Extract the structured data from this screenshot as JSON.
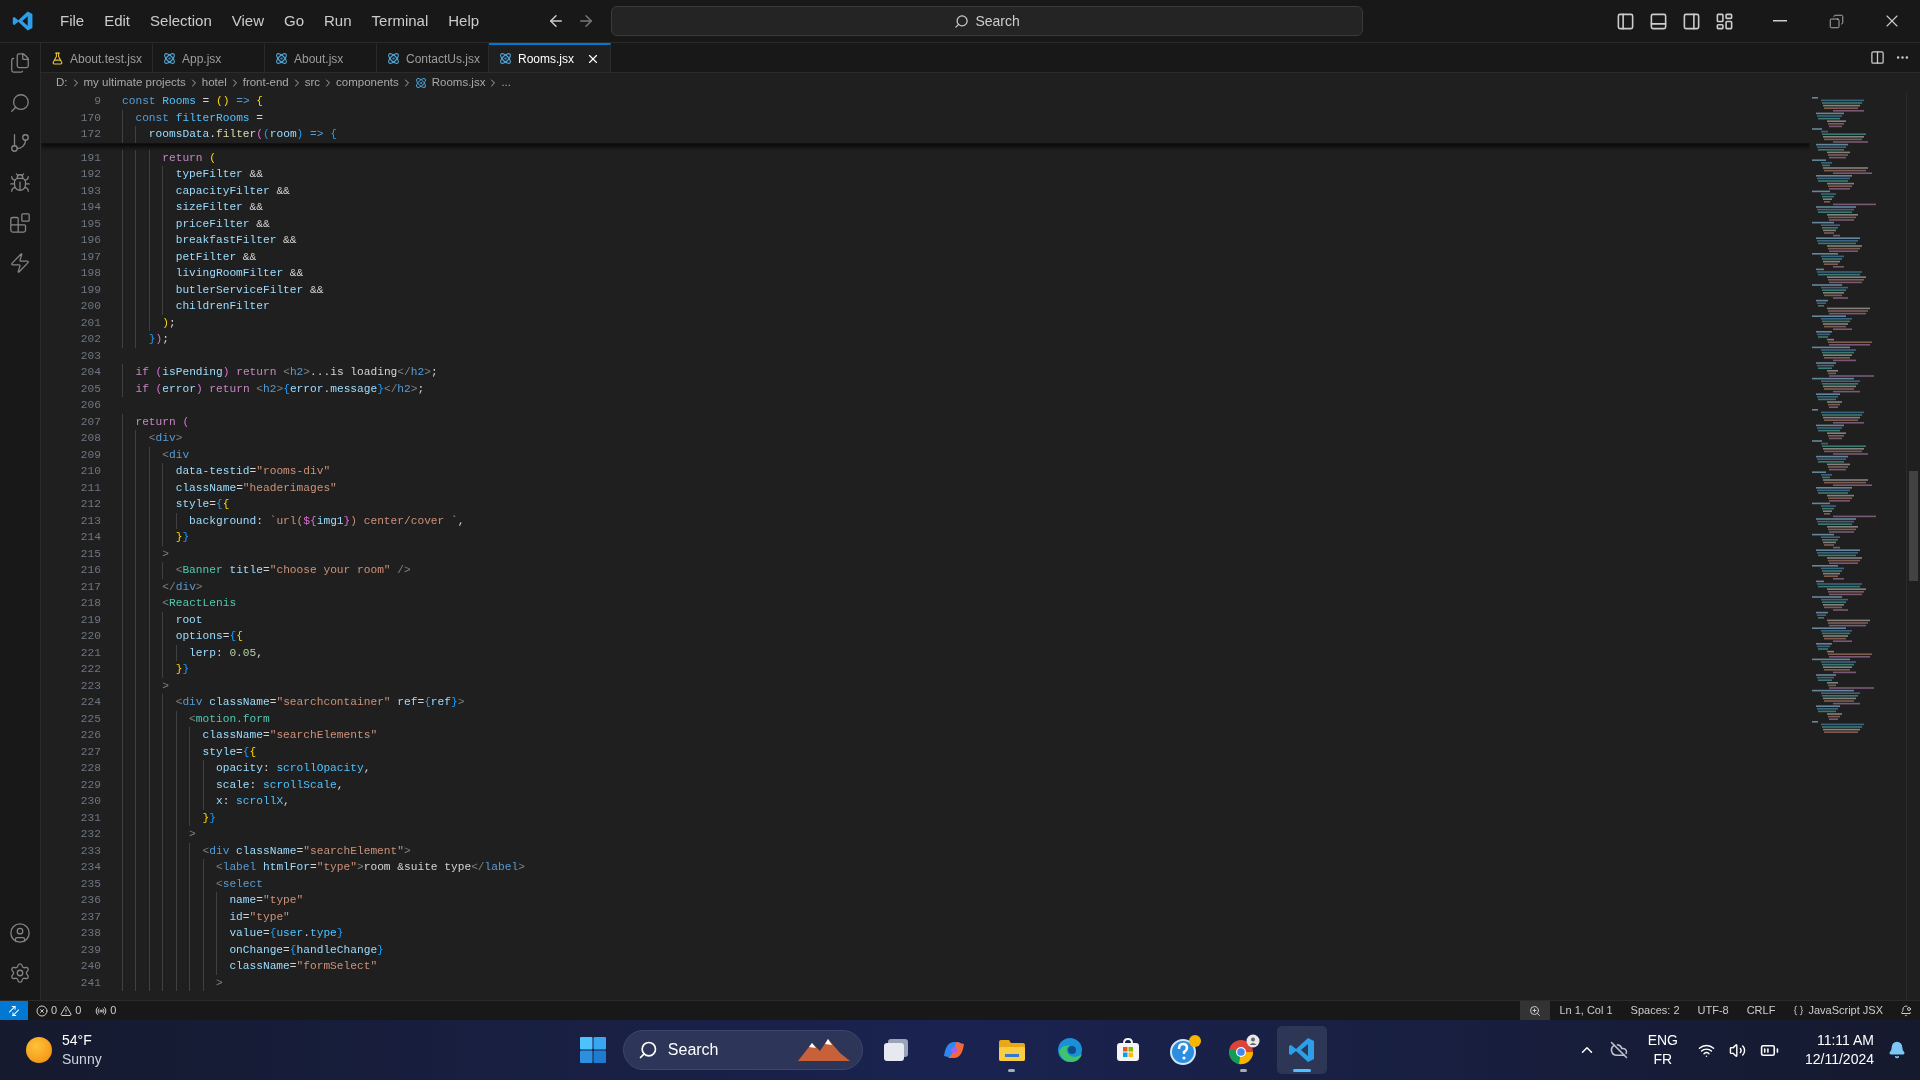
{
  "title_bar": {
    "menu": [
      "File",
      "Edit",
      "Selection",
      "View",
      "Go",
      "Run",
      "Terminal",
      "Help"
    ],
    "command_center": "Search"
  },
  "tabs": [
    {
      "label": "About.test.jsx",
      "kind": "test",
      "selected": false
    },
    {
      "label": "App.jsx",
      "kind": "react",
      "selected": false
    },
    {
      "label": "About.jsx",
      "kind": "react",
      "selected": false
    },
    {
      "label": "ContactUs.jsx",
      "kind": "react",
      "selected": false
    },
    {
      "label": "Rooms.jsx",
      "kind": "react",
      "selected": true
    }
  ],
  "breadcrumb": [
    {
      "label": "D:",
      "kind": "folder"
    },
    {
      "label": "my ultimate projects",
      "kind": "folder"
    },
    {
      "label": "hotel",
      "kind": "folder"
    },
    {
      "label": "front-end",
      "kind": "folder"
    },
    {
      "label": "src",
      "kind": "folder"
    },
    {
      "label": "components",
      "kind": "folder"
    },
    {
      "label": "Rooms.jsx",
      "kind": "file"
    },
    {
      "label": "...",
      "kind": "more"
    }
  ],
  "sticky_lines": [
    {
      "n": "9",
      "tokens": [
        {
          "text": "const ",
          "kind": "storage"
        },
        {
          "text": "Rooms",
          "kind": "constant"
        },
        {
          "text": " = ",
          "kind": "plain"
        },
        {
          "text": "()",
          "kind": "bracket1"
        },
        {
          "text": " => ",
          "kind": "storage"
        },
        {
          "text": "{",
          "kind": "bracket1"
        }
      ]
    },
    {
      "n": "170",
      "tokens": [
        {
          "text": "  const ",
          "kind": "storage"
        },
        {
          "text": "filterRooms",
          "kind": "constant"
        },
        {
          "text": " =",
          "kind": "plain"
        }
      ]
    },
    {
      "n": "172",
      "tokens": [
        {
          "text": "    roomsData",
          "kind": "variable"
        },
        {
          "text": ".",
          "kind": "plain"
        },
        {
          "text": "filter",
          "kind": "function"
        },
        {
          "text": "(",
          "kind": "bracket2"
        },
        {
          "text": "(",
          "kind": "bracket3"
        },
        {
          "text": "room",
          "kind": "variable"
        },
        {
          "text": ")",
          "kind": "bracket3"
        },
        {
          "text": " => ",
          "kind": "storage"
        },
        {
          "text": "{",
          "kind": "bracket3"
        }
      ]
    }
  ],
  "lines": [
    {
      "n": "191",
      "tokens": [
        {
          "text": "      return ",
          "kind": "keyword"
        },
        {
          "text": "(",
          "kind": "bracket1"
        }
      ]
    },
    {
      "n": "192",
      "tokens": [
        {
          "text": "        typeFilter",
          "kind": "variable"
        },
        {
          "text": " &&",
          "kind": "plain"
        }
      ]
    },
    {
      "n": "193",
      "tokens": [
        {
          "text": "        capacityFilter",
          "kind": "variable"
        },
        {
          "text": " &&",
          "kind": "plain"
        }
      ]
    },
    {
      "n": "194",
      "tokens": [
        {
          "text": "        sizeFilter",
          "kind": "variable"
        },
        {
          "text": " &&",
          "kind": "plain"
        }
      ]
    },
    {
      "n": "195",
      "tokens": [
        {
          "text": "        priceFilter",
          "kind": "variable"
        },
        {
          "text": " &&",
          "kind": "plain"
        }
      ]
    },
    {
      "n": "196",
      "tokens": [
        {
          "text": "        breakfastFilter",
          "kind": "variable"
        },
        {
          "text": " &&",
          "kind": "plain"
        }
      ]
    },
    {
      "n": "197",
      "tokens": [
        {
          "text": "        petFilter",
          "kind": "variable"
        },
        {
          "text": " &&",
          "kind": "plain"
        }
      ]
    },
    {
      "n": "198",
      "tokens": [
        {
          "text": "        livingRoomFilter",
          "kind": "variable"
        },
        {
          "text": " &&",
          "kind": "plain"
        }
      ]
    },
    {
      "n": "199",
      "tokens": [
        {
          "text": "        butlerServiceFilter",
          "kind": "variable"
        },
        {
          "text": " &&",
          "kind": "plain"
        }
      ]
    },
    {
      "n": "200",
      "tokens": [
        {
          "text": "        childrenFilter",
          "kind": "variable"
        }
      ]
    },
    {
      "n": "201",
      "tokens": [
        {
          "text": "      )",
          "kind": "bracket1"
        },
        {
          "text": ";",
          "kind": "plain"
        }
      ]
    },
    {
      "n": "202",
      "tokens": [
        {
          "text": "    }",
          "kind": "bracket3"
        },
        {
          "text": ")",
          "kind": "bracket2"
        },
        {
          "text": ";",
          "kind": "plain"
        }
      ]
    },
    {
      "n": "203"
    },
    {
      "n": "204",
      "tokens": [
        {
          "text": "  if ",
          "kind": "keyword"
        },
        {
          "text": "(",
          "kind": "bracket2"
        },
        {
          "text": "isPending",
          "kind": "variable"
        },
        {
          "text": ")",
          "kind": "bracket2"
        },
        {
          "text": " return ",
          "kind": "keyword"
        },
        {
          "text": "<",
          "kind": "punctuation"
        },
        {
          "text": "h2",
          "kind": "tag"
        },
        {
          "text": ">",
          "kind": "punctuation"
        },
        {
          "text": "...is loading",
          "kind": "plain"
        },
        {
          "text": "</",
          "kind": "punctuation"
        },
        {
          "text": "h2",
          "kind": "tag"
        },
        {
          "text": ">",
          "kind": "punctuation"
        },
        {
          "text": ";",
          "kind": "plain"
        }
      ]
    },
    {
      "n": "205",
      "tokens": [
        {
          "text": "  if ",
          "kind": "keyword"
        },
        {
          "text": "(",
          "kind": "bracket2"
        },
        {
          "text": "error",
          "kind": "variable"
        },
        {
          "text": ")",
          "kind": "bracket2"
        },
        {
          "text": " return ",
          "kind": "keyword"
        },
        {
          "text": "<",
          "kind": "punctuation"
        },
        {
          "text": "h2",
          "kind": "tag"
        },
        {
          "text": ">",
          "kind": "punctuation"
        },
        {
          "text": "{",
          "kind": "bracket3"
        },
        {
          "text": "error",
          "kind": "variable"
        },
        {
          "text": ".",
          "kind": "plain"
        },
        {
          "text": "message",
          "kind": "variable"
        },
        {
          "text": "}",
          "kind": "bracket3"
        },
        {
          "text": "</",
          "kind": "punctuation"
        },
        {
          "text": "h2",
          "kind": "tag"
        },
        {
          "text": ">",
          "kind": "punctuation"
        },
        {
          "text": ";",
          "kind": "plain"
        }
      ]
    },
    {
      "n": "206"
    },
    {
      "n": "207",
      "tokens": [
        {
          "text": "  return ",
          "kind": "keyword"
        },
        {
          "text": "(",
          "kind": "bracket2"
        }
      ]
    },
    {
      "n": "208",
      "tokens": [
        {
          "text": "    <",
          "kind": "punctuation"
        },
        {
          "text": "div",
          "kind": "tag"
        },
        {
          "text": ">",
          "kind": "punctuation"
        }
      ]
    },
    {
      "n": "209",
      "tokens": [
        {
          "text": "      <",
          "kind": "punctuation"
        },
        {
          "text": "div",
          "kind": "tag"
        }
      ]
    },
    {
      "n": "210",
      "tokens": [
        {
          "text": "        data-testid",
          "kind": "variable"
        },
        {
          "text": "=",
          "kind": "plain"
        },
        {
          "text": "\"rooms-div\"",
          "kind": "string"
        }
      ]
    },
    {
      "n": "211",
      "tokens": [
        {
          "text": "        className",
          "kind": "variable"
        },
        {
          "text": "=",
          "kind": "plain"
        },
        {
          "text": "\"headerimages\"",
          "kind": "string"
        }
      ]
    },
    {
      "n": "212",
      "tokens": [
        {
          "text": "        style",
          "kind": "variable"
        },
        {
          "text": "=",
          "kind": "plain"
        },
        {
          "text": "{",
          "kind": "bracket3"
        },
        {
          "text": "{",
          "kind": "bracket1"
        }
      ]
    },
    {
      "n": "213",
      "tokens": [
        {
          "text": "          background",
          "kind": "variable"
        },
        {
          "text": ": ",
          "kind": "plain"
        },
        {
          "text": "`url(",
          "kind": "string"
        },
        {
          "text": "${",
          "kind": "bracket2"
        },
        {
          "text": "img1",
          "kind": "variable"
        },
        {
          "text": "}",
          "kind": "bracket2"
        },
        {
          "text": ") center/cover `",
          "kind": "string"
        },
        {
          "text": ",",
          "kind": "plain"
        }
      ]
    },
    {
      "n": "214",
      "tokens": [
        {
          "text": "        }",
          "kind": "bracket1"
        },
        {
          "text": "}",
          "kind": "bracket3"
        }
      ]
    },
    {
      "n": "215",
      "tokens": [
        {
          "text": "      >",
          "kind": "punctuation"
        }
      ]
    },
    {
      "n": "216",
      "tokens": [
        {
          "text": "        <",
          "kind": "punctuation"
        },
        {
          "text": "Banner",
          "kind": "component"
        },
        {
          "text": " title",
          "kind": "variable"
        },
        {
          "text": "=",
          "kind": "plain"
        },
        {
          "text": "\"choose your room\"",
          "kind": "string"
        },
        {
          "text": " />",
          "kind": "punctuation"
        }
      ]
    },
    {
      "n": "217",
      "tokens": [
        {
          "text": "      </",
          "kind": "punctuation"
        },
        {
          "text": "div",
          "kind": "tag"
        },
        {
          "text": ">",
          "kind": "punctuation"
        }
      ]
    },
    {
      "n": "218",
      "tokens": [
        {
          "text": "      <",
          "kind": "punctuation"
        },
        {
          "text": "ReactLenis",
          "kind": "component"
        }
      ]
    },
    {
      "n": "219",
      "tokens": [
        {
          "text": "        root",
          "kind": "variable"
        }
      ]
    },
    {
      "n": "220",
      "tokens": [
        {
          "text": "        options",
          "kind": "variable"
        },
        {
          "text": "=",
          "kind": "plain"
        },
        {
          "text": "{",
          "kind": "bracket3"
        },
        {
          "text": "{",
          "kind": "bracket1"
        }
      ]
    },
    {
      "n": "221",
      "tokens": [
        {
          "text": "          lerp",
          "kind": "variable"
        },
        {
          "text": ": ",
          "kind": "plain"
        },
        {
          "text": "0.05",
          "kind": "number"
        },
        {
          "text": ",",
          "kind": "plain"
        }
      ]
    },
    {
      "n": "222",
      "tokens": [
        {
          "text": "        }",
          "kind": "bracket1"
        },
        {
          "text": "}",
          "kind": "bracket3"
        }
      ]
    },
    {
      "n": "223",
      "tokens": [
        {
          "text": "      >",
          "kind": "punctuation"
        }
      ]
    },
    {
      "n": "224",
      "tokens": [
        {
          "text": "        <",
          "kind": "punctuation"
        },
        {
          "text": "div",
          "kind": "tag"
        },
        {
          "text": " className",
          "kind": "variable"
        },
        {
          "text": "=",
          "kind": "plain"
        },
        {
          "text": "\"searchcontainer\"",
          "kind": "string"
        },
        {
          "text": " ref",
          "kind": "variable"
        },
        {
          "text": "=",
          "kind": "plain"
        },
        {
          "text": "{",
          "kind": "bracket3"
        },
        {
          "text": "ref",
          "kind": "variable"
        },
        {
          "text": "}",
          "kind": "bracket3"
        },
        {
          "text": ">",
          "kind": "punctuation"
        }
      ]
    },
    {
      "n": "225",
      "tokens": [
        {
          "text": "          <",
          "kind": "punctuation"
        },
        {
          "text": "motion.form",
          "kind": "component"
        }
      ]
    },
    {
      "n": "226",
      "tokens": [
        {
          "text": "            className",
          "kind": "variable"
        },
        {
          "text": "=",
          "kind": "plain"
        },
        {
          "text": "\"searchElements\"",
          "kind": "string"
        }
      ]
    },
    {
      "n": "227",
      "tokens": [
        {
          "text": "            style",
          "kind": "variable"
        },
        {
          "text": "=",
          "kind": "plain"
        },
        {
          "text": "{",
          "kind": "bracket3"
        },
        {
          "text": "{",
          "kind": "bracket1"
        }
      ]
    },
    {
      "n": "228",
      "tokens": [
        {
          "text": "              opacity",
          "kind": "variable"
        },
        {
          "text": ": ",
          "kind": "plain"
        },
        {
          "text": "scrollOpacity",
          "kind": "constant"
        },
        {
          "text": ",",
          "kind": "plain"
        }
      ]
    },
    {
      "n": "229",
      "tokens": [
        {
          "text": "              scale",
          "kind": "variable"
        },
        {
          "text": ": ",
          "kind": "plain"
        },
        {
          "text": "scrollScale",
          "kind": "constant"
        },
        {
          "text": ",",
          "kind": "plain"
        }
      ]
    },
    {
      "n": "230",
      "tokens": [
        {
          "text": "              x",
          "kind": "variable"
        },
        {
          "text": ": ",
          "kind": "plain"
        },
        {
          "text": "scrollX",
          "kind": "constant"
        },
        {
          "text": ",",
          "kind": "plain"
        }
      ]
    },
    {
      "n": "231",
      "tokens": [
        {
          "text": "            }",
          "kind": "bracket1"
        },
        {
          "text": "}",
          "kind": "bracket3"
        }
      ]
    },
    {
      "n": "232",
      "tokens": [
        {
          "text": "          >",
          "kind": "punctuation"
        }
      ]
    },
    {
      "n": "233",
      "tokens": [
        {
          "text": "            <",
          "kind": "punctuation"
        },
        {
          "text": "div",
          "kind": "tag"
        },
        {
          "text": " className",
          "kind": "variable"
        },
        {
          "text": "=",
          "kind": "plain"
        },
        {
          "text": "\"searchElement\"",
          "kind": "string"
        },
        {
          "text": ">",
          "kind": "punctuation"
        }
      ]
    },
    {
      "n": "234",
      "tokens": [
        {
          "text": "              <",
          "kind": "punctuation"
        },
        {
          "text": "label",
          "kind": "tag"
        },
        {
          "text": " htmlFor",
          "kind": "variable"
        },
        {
          "text": "=",
          "kind": "plain"
        },
        {
          "text": "\"type\"",
          "kind": "string"
        },
        {
          "text": ">",
          "kind": "punctuation"
        },
        {
          "text": "room &suite type",
          "kind": "plain"
        },
        {
          "text": "</",
          "kind": "punctuation"
        },
        {
          "text": "label",
          "kind": "tag"
        },
        {
          "text": ">",
          "kind": "punctuation"
        }
      ]
    },
    {
      "n": "235",
      "tokens": [
        {
          "text": "              <",
          "kind": "punctuation"
        },
        {
          "text": "select",
          "kind": "tag"
        }
      ]
    },
    {
      "n": "236",
      "tokens": [
        {
          "text": "                name",
          "kind": "variable"
        },
        {
          "text": "=",
          "kind": "plain"
        },
        {
          "text": "\"type\"",
          "kind": "string"
        }
      ]
    },
    {
      "n": "237",
      "tokens": [
        {
          "text": "                id",
          "kind": "variable"
        },
        {
          "text": "=",
          "kind": "plain"
        },
        {
          "text": "\"type\"",
          "kind": "string"
        }
      ]
    },
    {
      "n": "238",
      "tokens": [
        {
          "text": "                value",
          "kind": "variable"
        },
        {
          "text": "=",
          "kind": "plain"
        },
        {
          "text": "{",
          "kind": "bracket3"
        },
        {
          "text": "user",
          "kind": "constant"
        },
        {
          "text": ".",
          "kind": "plain"
        },
        {
          "text": "type",
          "kind": "constant"
        },
        {
          "text": "}",
          "kind": "bracket3"
        }
      ]
    },
    {
      "n": "239",
      "tokens": [
        {
          "text": "                onChange",
          "kind": "variable"
        },
        {
          "text": "=",
          "kind": "plain"
        },
        {
          "text": "{",
          "kind": "bracket3"
        },
        {
          "text": "handleChange",
          "kind": "variable"
        },
        {
          "text": "}",
          "kind": "bracket3"
        }
      ]
    },
    {
      "n": "240",
      "tokens": [
        {
          "text": "                className",
          "kind": "variable"
        },
        {
          "text": "=",
          "kind": "plain"
        },
        {
          "text": "\"formSelect\"",
          "kind": "string"
        }
      ]
    },
    {
      "n": "241",
      "tokens": [
        {
          "text": "              >",
          "kind": "punctuation"
        }
      ]
    }
  ],
  "status_bar": {
    "errors": "0",
    "warnings": "0",
    "ports": "0",
    "position": "Ln 1, Col 1",
    "indentation": "Spaces: 2",
    "encoding": "UTF-8",
    "eol": "CRLF",
    "language": "JavaScript JSX"
  },
  "taskbar": {
    "weather": {
      "temperature": "54°F",
      "condition": "Sunny"
    },
    "search": "Search",
    "apps": [
      {
        "kind": "taskview",
        "running": false
      },
      {
        "kind": "copilot",
        "running": false
      },
      {
        "kind": "folder",
        "running": true
      },
      {
        "kind": "edge",
        "running": false
      },
      {
        "kind": "store",
        "running": false
      },
      {
        "kind": "help",
        "running": false
      },
      {
        "kind": "chrome",
        "running": true
      },
      {
        "kind": "vscode",
        "running": true
      }
    ],
    "language": [
      "ENG",
      "FR"
    ],
    "time": "11:11 AM",
    "date": "12/11/2024"
  }
}
